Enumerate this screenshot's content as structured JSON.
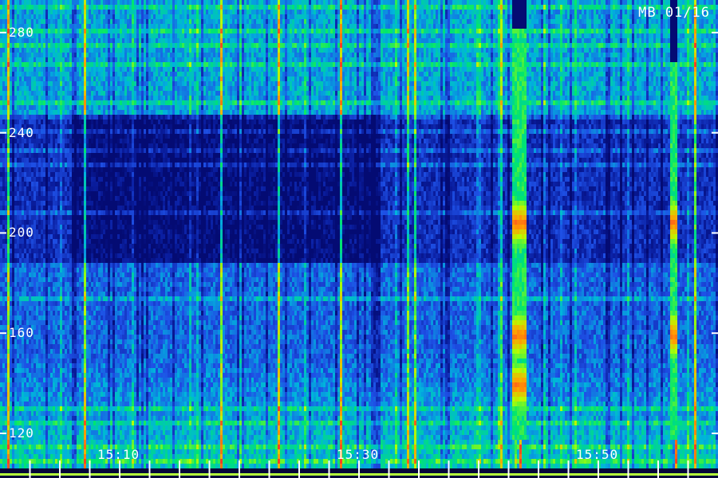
{
  "title": "MB 01/16",
  "chart_data": {
    "type": "heatmap",
    "title": "MB 01/16",
    "xlabel": "",
    "ylabel": "",
    "y_ticks": [
      120,
      160,
      200,
      240,
      280
    ],
    "y_range": [
      106,
      293
    ],
    "x_ticks": [
      "15:10",
      "15:30",
      "15:50"
    ],
    "x_range": [
      "15:00",
      "16:00"
    ],
    "x_minor_tick_interval_min": 2.5,
    "colormap": [
      "#00005a",
      "#0a1ea0",
      "#1e50e6",
      "#00b4dc",
      "#00e66e",
      "#b4ff00",
      "#ffa000",
      "#ff3c28"
    ],
    "bright_bursts": [
      {
        "start": "15:42:40",
        "end": "15:43:55",
        "freq_from": 118,
        "freq_to": 282,
        "intensity": "high",
        "peak_freqs": [
          205,
          160,
          140
        ]
      },
      {
        "start": "15:55:50",
        "end": "15:56:25",
        "freq_from": 118,
        "freq_to": 270,
        "intensity": "high",
        "peak_freqs": [
          205,
          160
        ]
      }
    ],
    "colorbar": false,
    "legend": false
  }
}
